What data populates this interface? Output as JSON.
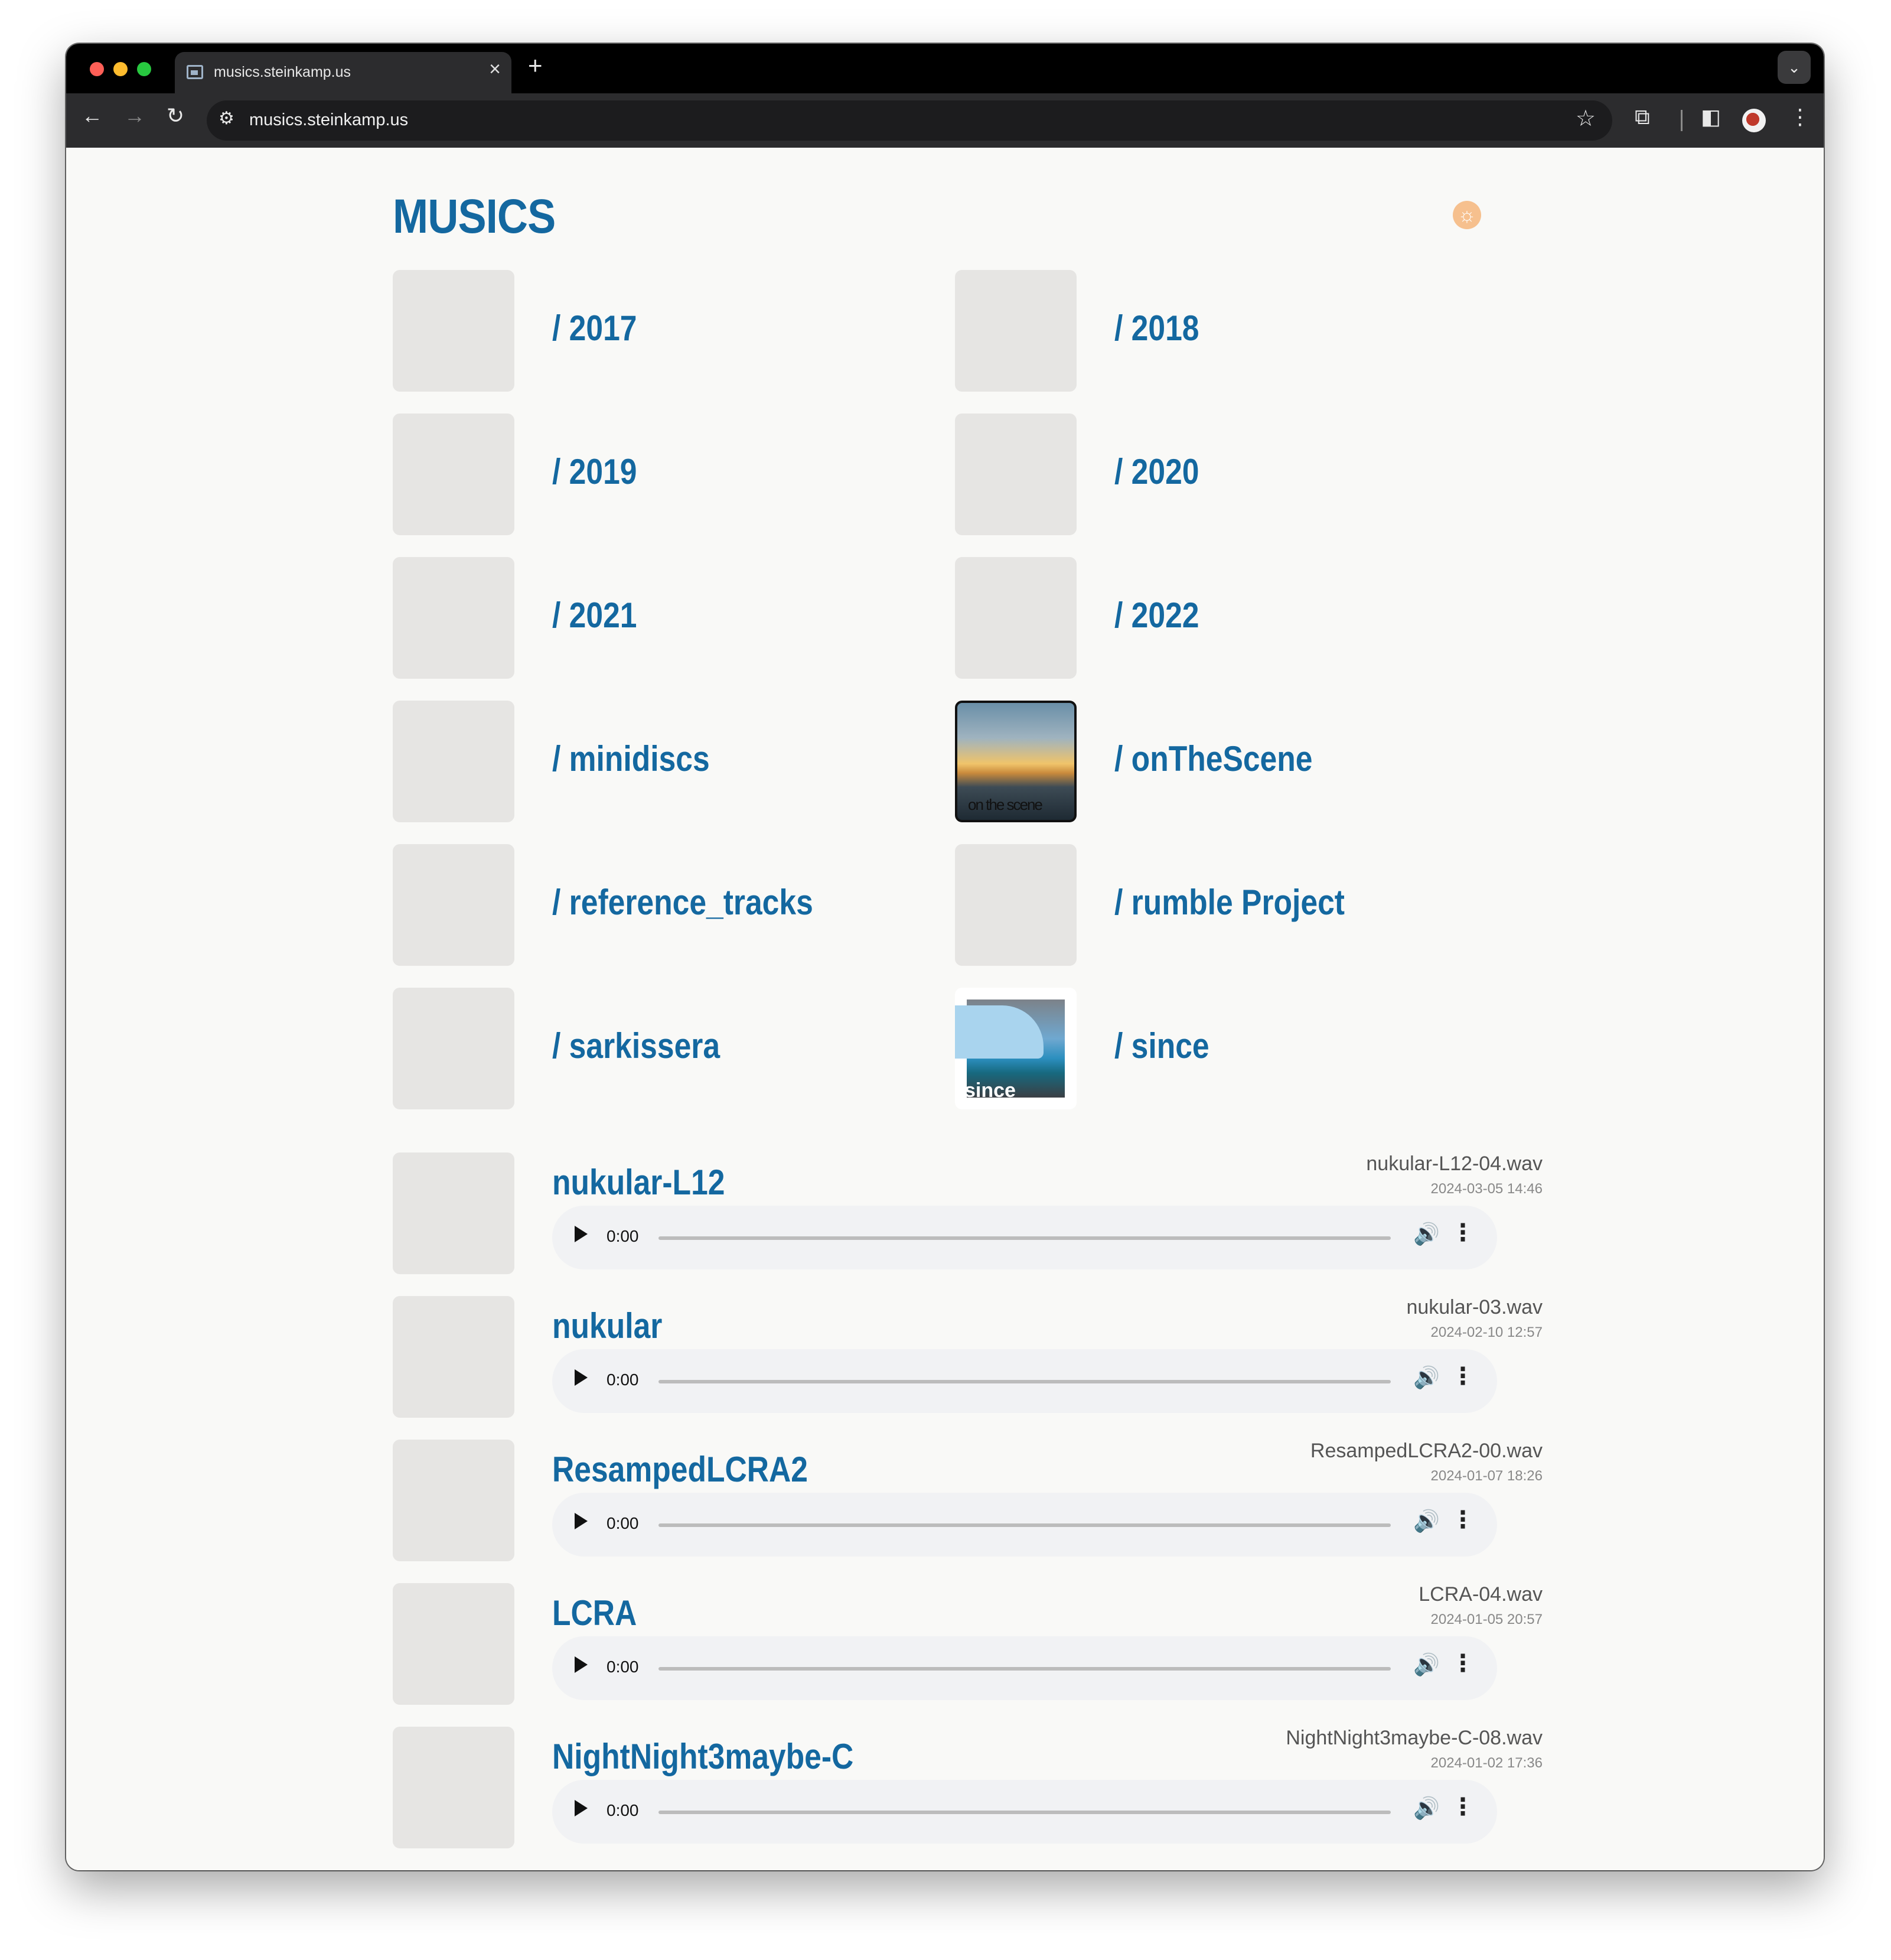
{
  "browser": {
    "tab_title": "musics.steinkamp.us",
    "tab_close": "×",
    "new_tab": "+",
    "tab_search": "⌄",
    "url": "musics.steinkamp.us",
    "icons": {
      "back": "←",
      "forward": "→",
      "reload": "↻",
      "site_info": "⚙",
      "bookmark": "☆",
      "extensions": "⧉",
      "side_panel": "◧",
      "menu": "⋮"
    }
  },
  "page": {
    "title": "MUSICS",
    "theme_toggle_icon": "☼",
    "accent_color": "#1468a0"
  },
  "folders": [
    {
      "label": "/ 2017"
    },
    {
      "label": "/ 2018"
    },
    {
      "label": "/ 2019"
    },
    {
      "label": "/ 2020"
    },
    {
      "label": "/ 2021"
    },
    {
      "label": "/ 2022"
    },
    {
      "label": "/ minidiscs"
    },
    {
      "label": "/ onTheScene",
      "art_caption": "on the scene"
    },
    {
      "label": "/ reference_tracks"
    },
    {
      "label": "/ rumble Project"
    },
    {
      "label": "/ sarkissera"
    },
    {
      "label": "/ since",
      "art_caption": "since"
    }
  ],
  "tracks": [
    {
      "title": "nukular-L12",
      "file": "nukular-L12-04.wav",
      "date": "2024-03-05 14:46",
      "time": "0:00"
    },
    {
      "title": "nukular",
      "file": "nukular-03.wav",
      "date": "2024-02-10 12:57",
      "time": "0:00"
    },
    {
      "title": "ResampedLCRA2",
      "file": "ResampedLCRA2-00.wav",
      "date": "2024-01-07 18:26",
      "time": "0:00"
    },
    {
      "title": "LCRA",
      "file": "LCRA-04.wav",
      "date": "2024-01-05 20:57",
      "time": "0:00"
    },
    {
      "title": "NightNight3maybe-C",
      "file": "NightNight3maybe-C-08.wav",
      "date": "2024-01-02 17:36",
      "time": "0:00"
    }
  ],
  "player_icons": {
    "volume": "🔊",
    "more": "⋮"
  }
}
